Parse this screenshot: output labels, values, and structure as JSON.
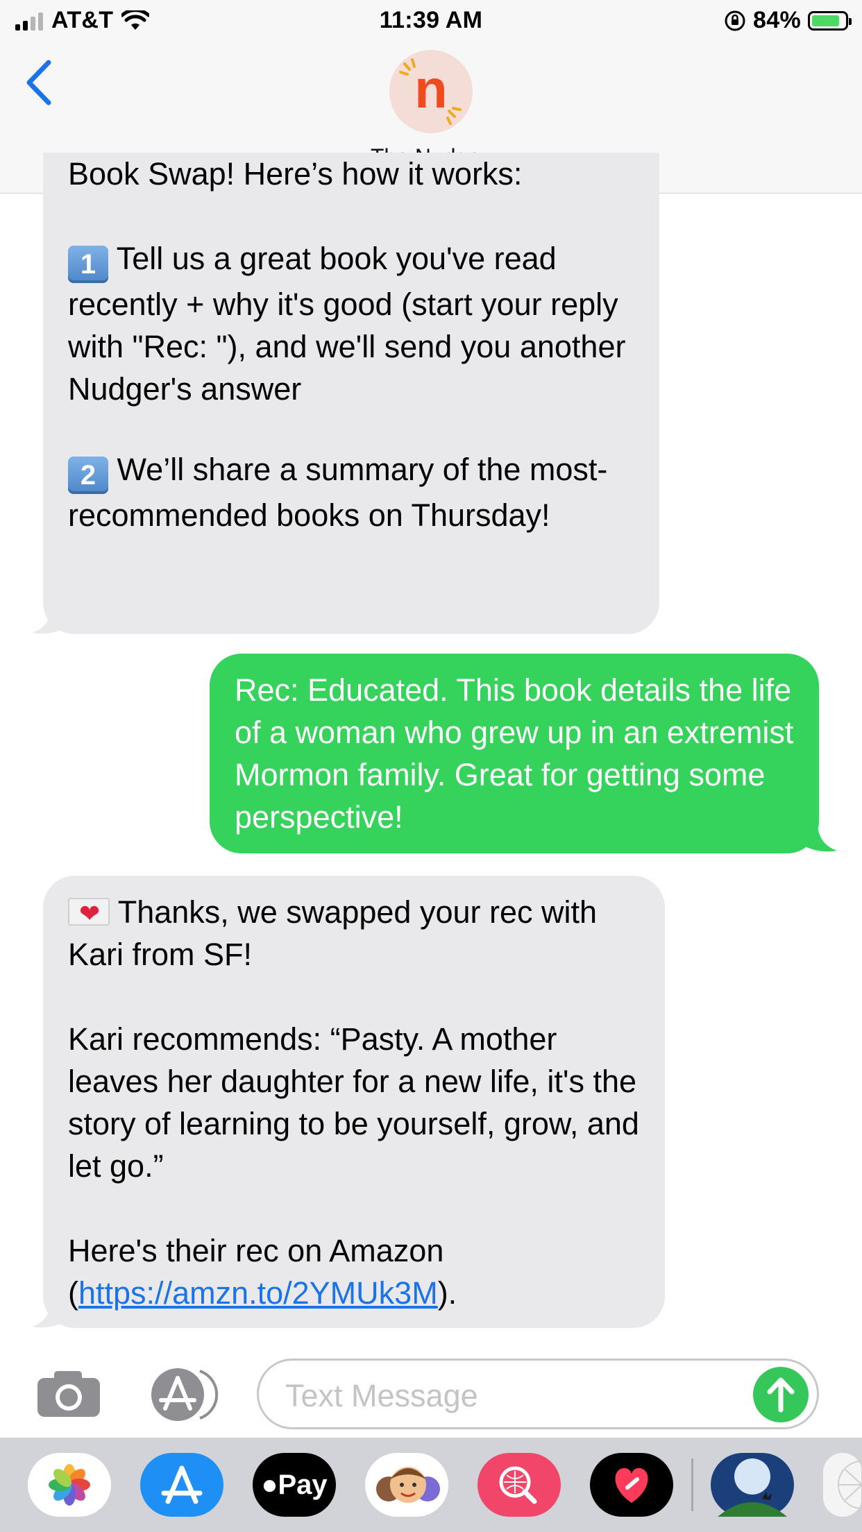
{
  "status_bar": {
    "carrier": "AT&T",
    "time": "11:39 AM",
    "battery": "84%",
    "battery_level": 0.84
  },
  "nav": {
    "avatar_letter": "n",
    "contact_name": "The Nudge"
  },
  "messages": [
    {
      "direction": "incoming",
      "line1": "Book Swap! Here’s how it works:",
      "item1_key": "1",
      "item1": "Tell us a great book you've read recently + why it's good (start your reply with \"Rec: \"), and we'll send you another Nudger's answer",
      "item2_key": "2",
      "item2": "We’ll share a summary of the most-recommended books on Thursday!"
    },
    {
      "direction": "outgoing",
      "text": "Rec: Educated. This book details the life of a woman who grew up in an extremist Mormon family. Great for getting some perspective!"
    },
    {
      "direction": "incoming",
      "intro": "Thanks, we swapped your rec with Kari from SF!",
      "quote": "Kari recommends: “Pasty. A mother leaves her daughter for a new life, it's the story of learning to be yourself, grow, and let go.”",
      "link_prefix": "Here's their rec on Amazon (",
      "link": "https://amzn.to/2YMUk3M",
      "link_suffix": ")."
    }
  ],
  "composer": {
    "placeholder": "Text Message"
  },
  "drawer": {
    "apple_pay_label": "Pay"
  },
  "icons": {
    "back": "chevron-left-icon",
    "camera": "camera-icon",
    "apps": "app-store-icon",
    "send": "arrow-up-icon"
  },
  "colors": {
    "ios_blue": "#1a73e8",
    "sms_green": "#35d35b",
    "incoming_gray": "#e9e9eb"
  }
}
